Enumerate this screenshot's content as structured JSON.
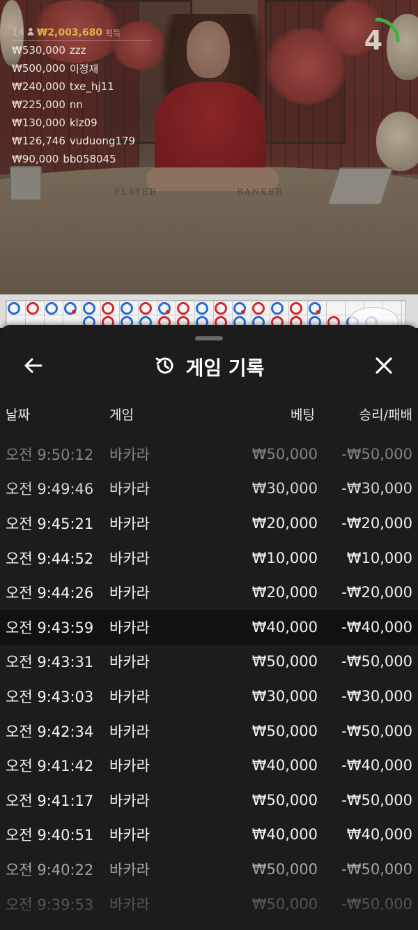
{
  "leaderboard": {
    "header": {
      "count": "14",
      "amount": "₩2,003,680",
      "label": "획득"
    },
    "entries": [
      {
        "amount": "₩530,000",
        "name": "zzz"
      },
      {
        "amount": "₩500,000",
        "name": "이정재"
      },
      {
        "amount": "₩240,000",
        "name": "txe_hj11"
      },
      {
        "amount": "₩225,000",
        "name": "nn"
      },
      {
        "amount": "₩130,000",
        "name": "klz09"
      },
      {
        "amount": "₩126,746",
        "name": "vuduong179"
      },
      {
        "amount": "₩90,000",
        "name": "bb058045"
      }
    ]
  },
  "timer": {
    "value": "4",
    "color": "#3fae49"
  },
  "table_labels": {
    "player": "PLAYER",
    "banker": "BANKER"
  },
  "bead_road": {
    "colors": {
      "blue": "#2b6bd1",
      "red": "#d3282f"
    }
  },
  "history": {
    "title": "게임 기록",
    "icons": {
      "back": "arrow-left-icon",
      "title": "history-icon",
      "close": "close-icon"
    },
    "columns": {
      "date": "날짜",
      "game": "게임",
      "bet": "베팅",
      "result": "승리/패배"
    },
    "rows": [
      {
        "date": "오전 9:50:12",
        "game": "바카라",
        "bet": "₩50,000",
        "result": "-₩50,000"
      },
      {
        "date": "오전 9:49:46",
        "game": "바카라",
        "bet": "₩30,000",
        "result": "-₩30,000"
      },
      {
        "date": "오전 9:45:21",
        "game": "바카라",
        "bet": "₩20,000",
        "result": "-₩20,000"
      },
      {
        "date": "오전 9:44:52",
        "game": "바카라",
        "bet": "₩10,000",
        "result": "₩10,000"
      },
      {
        "date": "오전 9:44:26",
        "game": "바카라",
        "bet": "₩20,000",
        "result": "-₩20,000"
      },
      {
        "date": "오전 9:43:59",
        "game": "바카라",
        "bet": "₩40,000",
        "result": "-₩40,000"
      },
      {
        "date": "오전 9:43:31",
        "game": "바카라",
        "bet": "₩50,000",
        "result": "-₩50,000"
      },
      {
        "date": "오전 9:43:03",
        "game": "바카라",
        "bet": "₩30,000",
        "result": "-₩30,000"
      },
      {
        "date": "오전 9:42:34",
        "game": "바카라",
        "bet": "₩50,000",
        "result": "-₩50,000"
      },
      {
        "date": "오전 9:41:42",
        "game": "바카라",
        "bet": "₩40,000",
        "result": "-₩40,000"
      },
      {
        "date": "오전 9:41:17",
        "game": "바카라",
        "bet": "₩50,000",
        "result": "-₩50,000"
      },
      {
        "date": "오전 9:40:51",
        "game": "바카라",
        "bet": "₩40,000",
        "result": "₩40,000"
      },
      {
        "date": "오전 9:40:22",
        "game": "바카라",
        "bet": "₩50,000",
        "result": "-₩50,000"
      },
      {
        "date": "오전 9:39:53",
        "game": "바카라",
        "bet": "₩50,000",
        "result": "-₩50,000"
      }
    ]
  }
}
